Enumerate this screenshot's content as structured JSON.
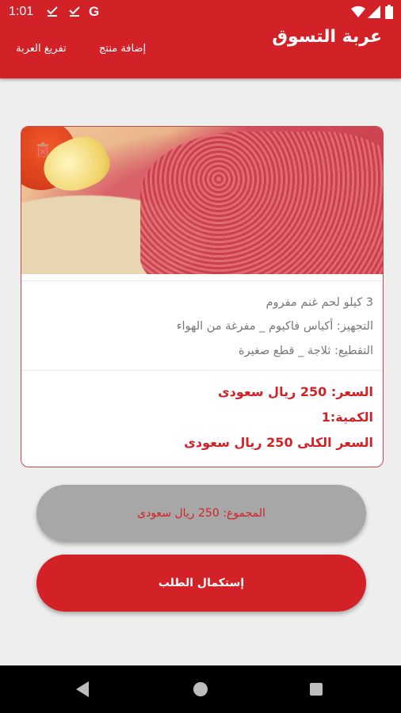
{
  "status_bar": {
    "time": "1:01",
    "icons": [
      "download-done-icon",
      "download-done-icon",
      "google-icon",
      "wifi-icon",
      "signal-icon",
      "battery-icon"
    ],
    "google_letter": "G"
  },
  "app_bar": {
    "title": "عربة التسوق",
    "add_product": "إضافة منتج",
    "empty_cart": "تفريغ العربة"
  },
  "cart": {
    "items": [
      {
        "image": "minced-meat-photo",
        "name": "3 كيلو لحم غنم مفروم",
        "preparation": "التجهيز: أكياس فاكيوم _ مفرغة من الهواء",
        "cutting": "التقطيع: ثلاجة _ قطع صغيرة",
        "price": "السعر: 250 ريال سعودى",
        "quantity": "الكمية:1",
        "line_total": "السعر الكلى 250 ريال سعودى"
      }
    ]
  },
  "summary": {
    "total": "المجموع: 250 ريال سعودى",
    "checkout": "إستكمال الطلب"
  },
  "colors": {
    "primary": "#d32128",
    "total_button_bg": "#a7a7a7",
    "background": "#eeeeee"
  }
}
